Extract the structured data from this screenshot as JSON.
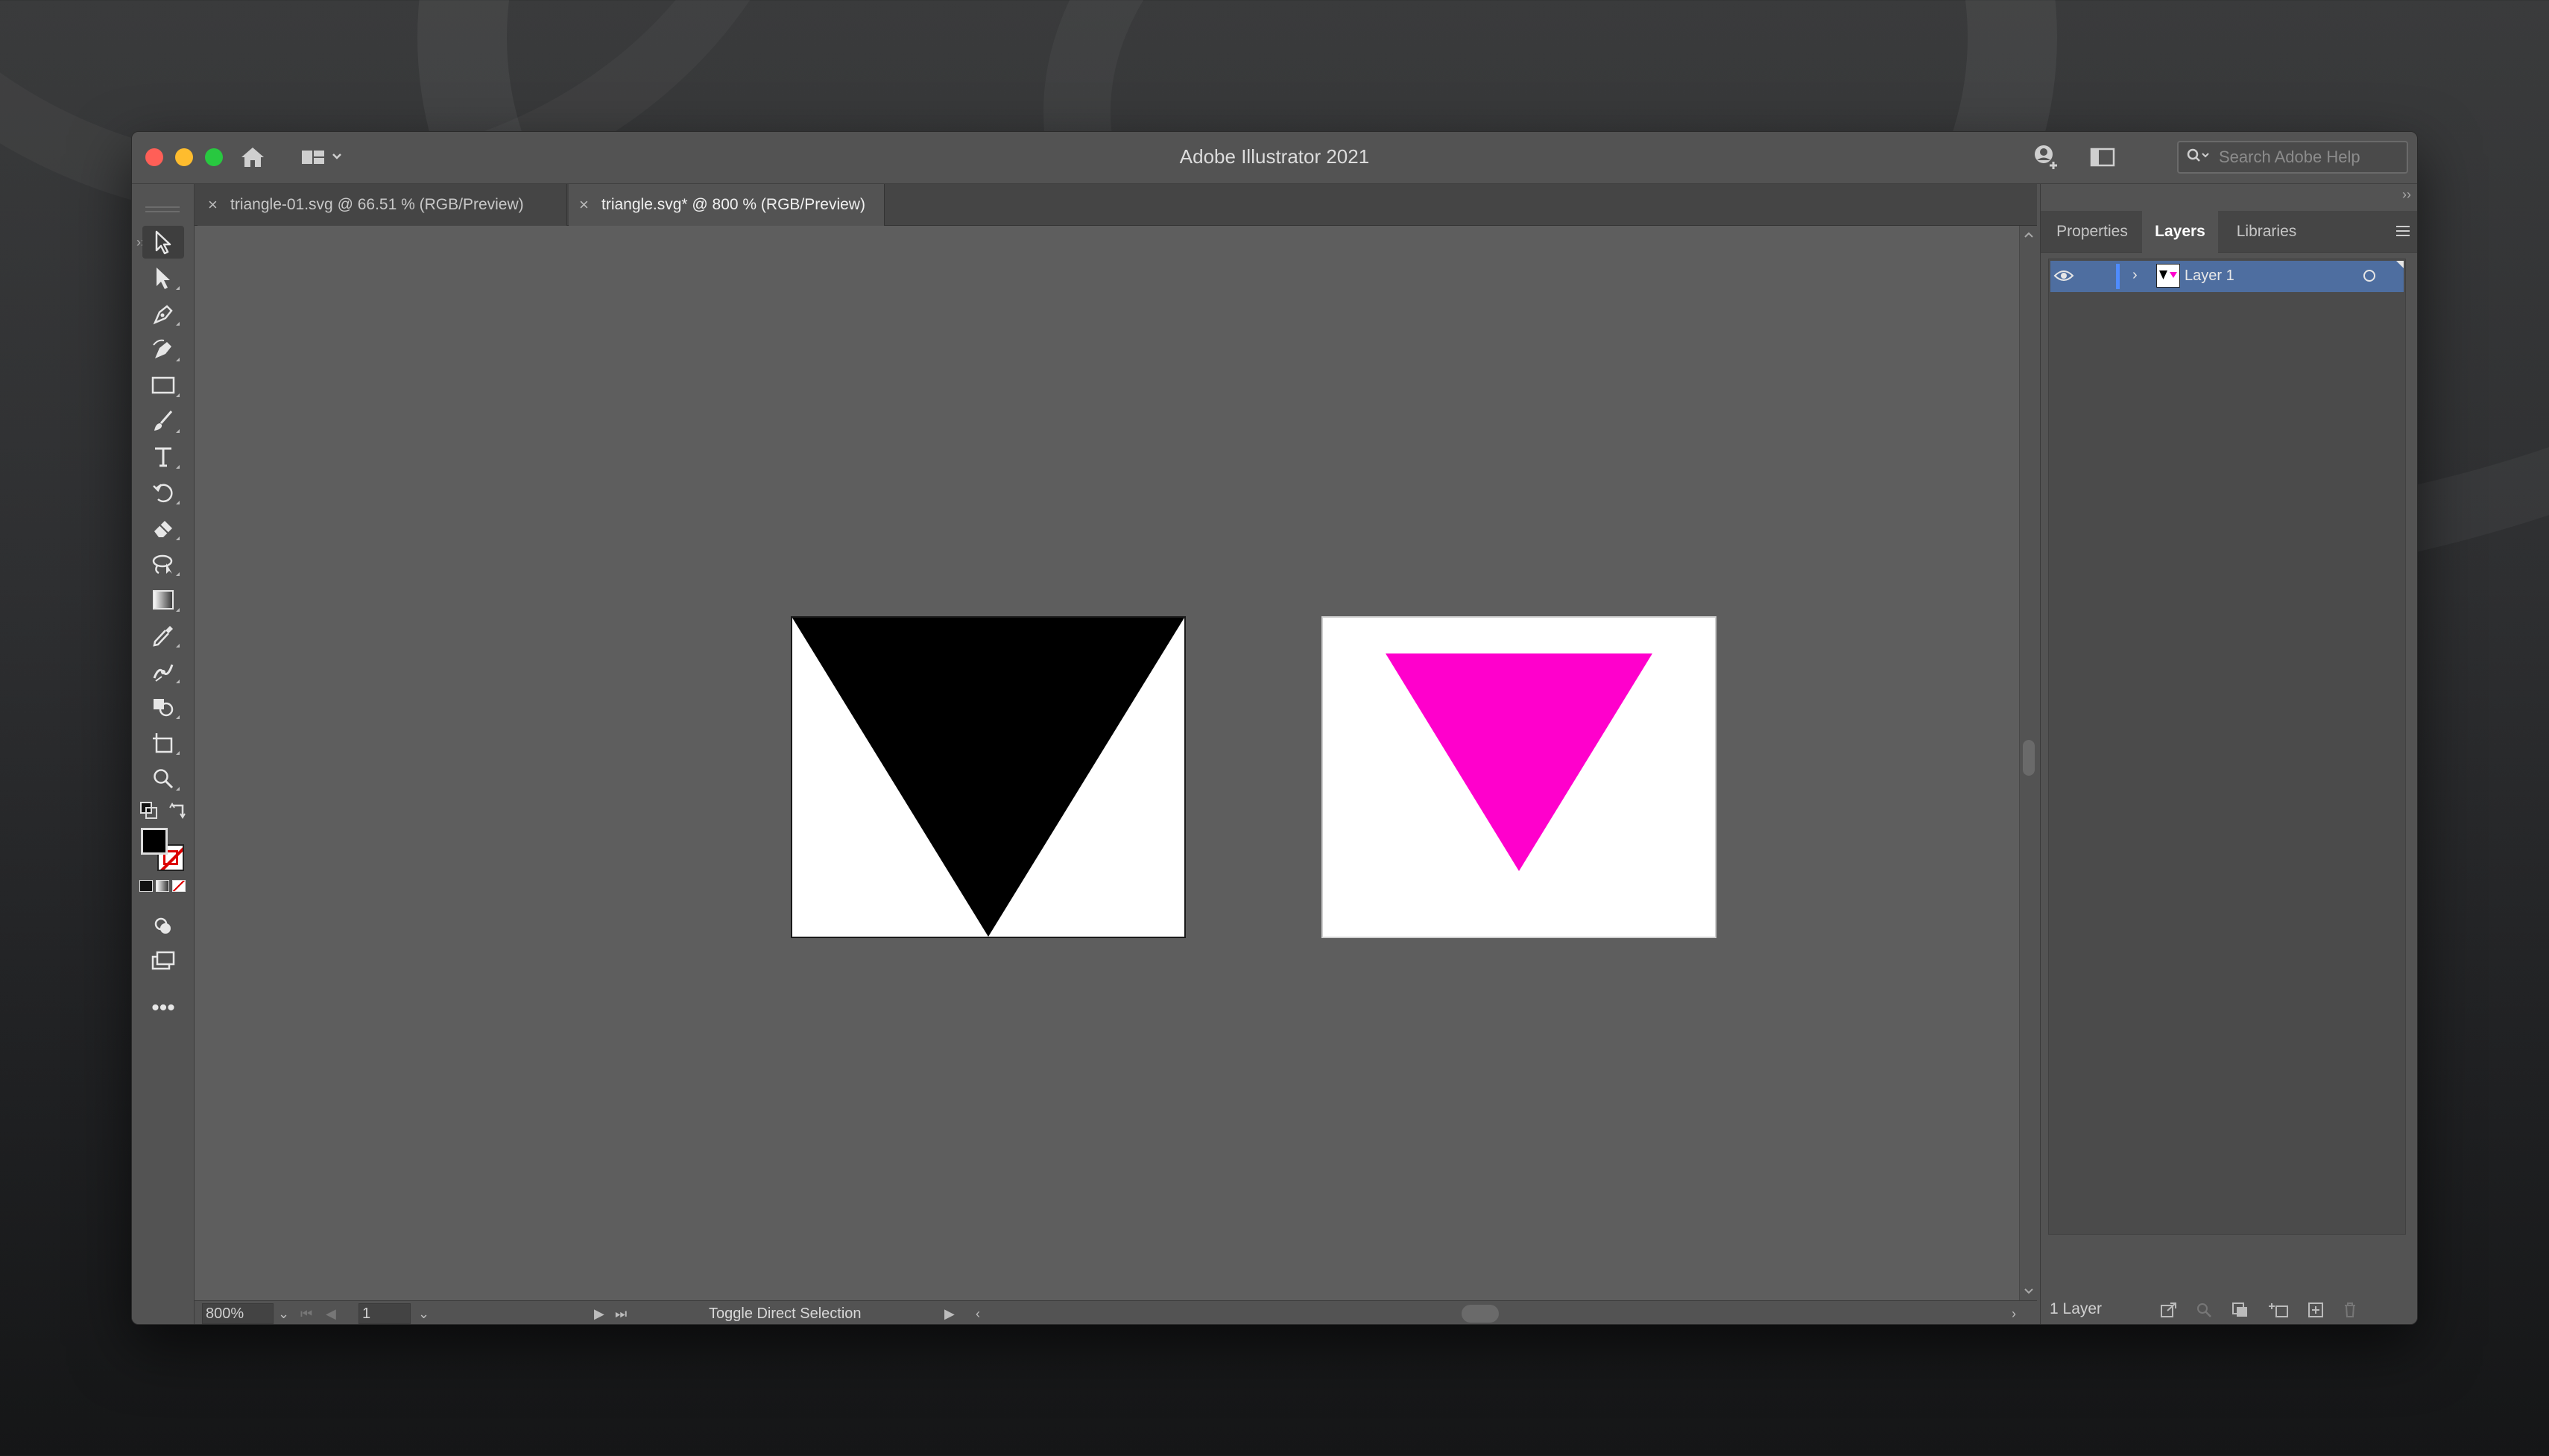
{
  "app": {
    "title": "Adobe Illustrator 2021",
    "help_search_placeholder": "Search Adobe Help"
  },
  "documents": {
    "tabs": [
      {
        "label": "triangle-01.svg @ 66.51 % (RGB/Preview)",
        "active": false
      },
      {
        "label": "triangle.svg* @ 800 % (RGB/Preview)",
        "active": true
      }
    ]
  },
  "toolbar": {
    "tools": [
      "selection-tool",
      "direct-selection-tool",
      "pen-tool",
      "curvature-tool",
      "rectangle-tool",
      "paintbrush-tool",
      "type-tool",
      "rotate-tool",
      "eraser-tool",
      "lasso-tool",
      "gradient-tool",
      "eyedropper-tool",
      "puppet-warp-tool",
      "shape-builder-tool",
      "artboard-tool",
      "zoom-tool"
    ],
    "fill_color": "#000000",
    "stroke_color": "none"
  },
  "canvas": {
    "artboards": [
      {
        "background": "#ffffff",
        "triangle_color": "#000000"
      },
      {
        "background": "#ffffff",
        "triangle_color": "#ff00cc"
      }
    ]
  },
  "status": {
    "zoom": "800%",
    "page": "1",
    "text": "Toggle Direct Selection"
  },
  "panel": {
    "tabs": [
      "Properties",
      "Layers",
      "Libraries"
    ],
    "active_tab": "Layers",
    "layers": [
      {
        "name": "Layer 1",
        "visible": true,
        "highlight_color": "#4e6ea0"
      }
    ],
    "footer_count": "1 Layer"
  }
}
